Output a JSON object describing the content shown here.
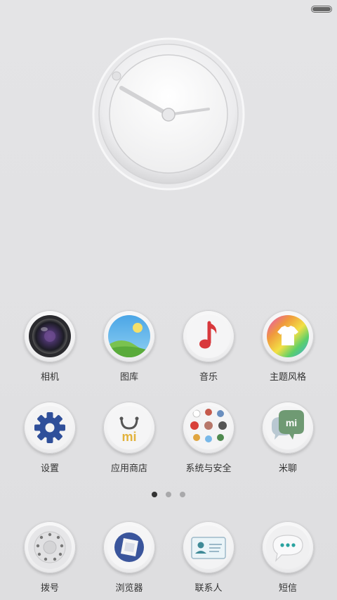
{
  "status_bar": {
    "battery_level": 1.0
  },
  "clock": {
    "hour_hand_deg": 300,
    "minute_hand_deg": 85
  },
  "apps_page": [
    {
      "id": "camera",
      "label": "相机",
      "icon": "camera-lens-icon"
    },
    {
      "id": "gallery",
      "label": "图库",
      "icon": "gallery-icon"
    },
    {
      "id": "music",
      "label": "音乐",
      "icon": "music-note-icon"
    },
    {
      "id": "themes",
      "label": "主题风格",
      "icon": "theme-shirt-icon"
    },
    {
      "id": "settings",
      "label": "设置",
      "icon": "gear-icon"
    },
    {
      "id": "app-store",
      "label": "应用商店",
      "icon": "shopping-bag-icon"
    },
    {
      "id": "system-security",
      "label": "系统与安全",
      "icon": "folder-icon"
    },
    {
      "id": "mitalk",
      "label": "米聊",
      "icon": "chat-bubble-icon"
    }
  ],
  "page_indicator": {
    "count": 3,
    "active": 0
  },
  "dock": [
    {
      "id": "dialer",
      "label": "拨号",
      "icon": "dialpad-icon"
    },
    {
      "id": "browser",
      "label": "浏览器",
      "icon": "browser-icon"
    },
    {
      "id": "contacts",
      "label": "联系人",
      "icon": "contact-card-icon"
    },
    {
      "id": "messages",
      "label": "短信",
      "icon": "message-icon"
    }
  ],
  "colors": {
    "gear": "#2f4f9a",
    "music_note": "#d8383c",
    "mitalk": "#6f9a73",
    "browser": "#3a559c",
    "label": "#333333"
  },
  "folder_mini_icons": [
    "mi",
    "w",
    "nfc",
    "nav",
    "video",
    "store",
    "file",
    "game",
    "mail"
  ]
}
